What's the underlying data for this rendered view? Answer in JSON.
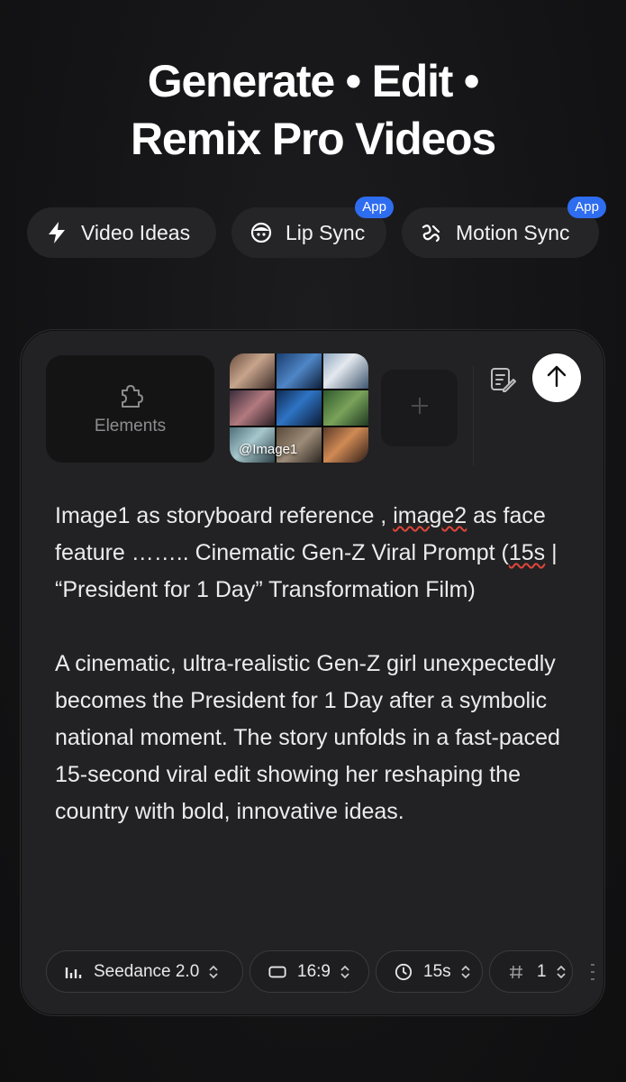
{
  "hero": {
    "line1": "Generate • Edit •",
    "line2": "Remix Pro Videos"
  },
  "chips": [
    {
      "label": "Video Ideas",
      "icon": "bolt-icon",
      "badge": ""
    },
    {
      "label": "Lip Sync",
      "icon": "face-icon",
      "badge": "App"
    },
    {
      "label": "Motion Sync",
      "icon": "motion-icon",
      "badge": "App"
    }
  ],
  "composer": {
    "elements_label": "Elements",
    "image_label": "@Image1",
    "prompt": {
      "p1_a": "Image1 as storyboard reference , ",
      "p1_err1": "image2",
      "p1_b": " as face feature …….. Cinematic Gen-Z Viral Prompt (",
      "p1_err2": "15s",
      "p1_c": " | “President for 1 Day” Transformation Film)",
      "p2": "A cinematic, ultra-realistic Gen-Z girl unexpectedly becomes the President for 1 Day after a symbolic national moment. The story unfolds in a fast-paced 15-second viral edit showing her reshaping the country with bold, innovative ideas."
    },
    "toolbar": {
      "model": "Seedance 2.0",
      "aspect": "16:9",
      "duration": "15s",
      "count": "1"
    }
  },
  "colors": {
    "accent": "#2f6df0",
    "background": "#141416",
    "card": "#222224",
    "spell_error": "#e0463a"
  }
}
